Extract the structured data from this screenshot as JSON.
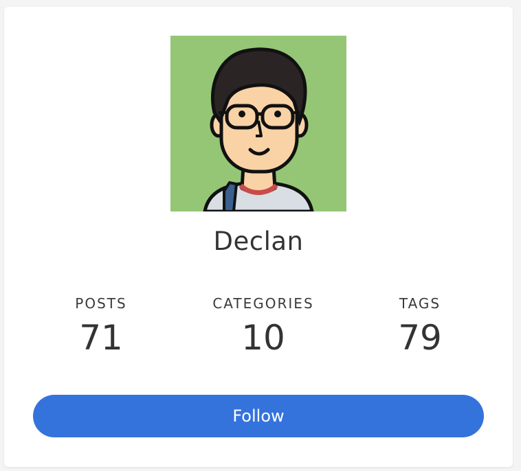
{
  "profile": {
    "name": "Declan",
    "avatar_icon": "cartoon-avatar-with-glasses",
    "avatar_bg": "#95c675"
  },
  "stats": {
    "posts": {
      "label": "POSTS",
      "value": "71"
    },
    "categories": {
      "label": "CATEGORIES",
      "value": "10"
    },
    "tags": {
      "label": "TAGS",
      "value": "79"
    }
  },
  "actions": {
    "follow_label": "Follow",
    "accent": "#3473dc"
  }
}
